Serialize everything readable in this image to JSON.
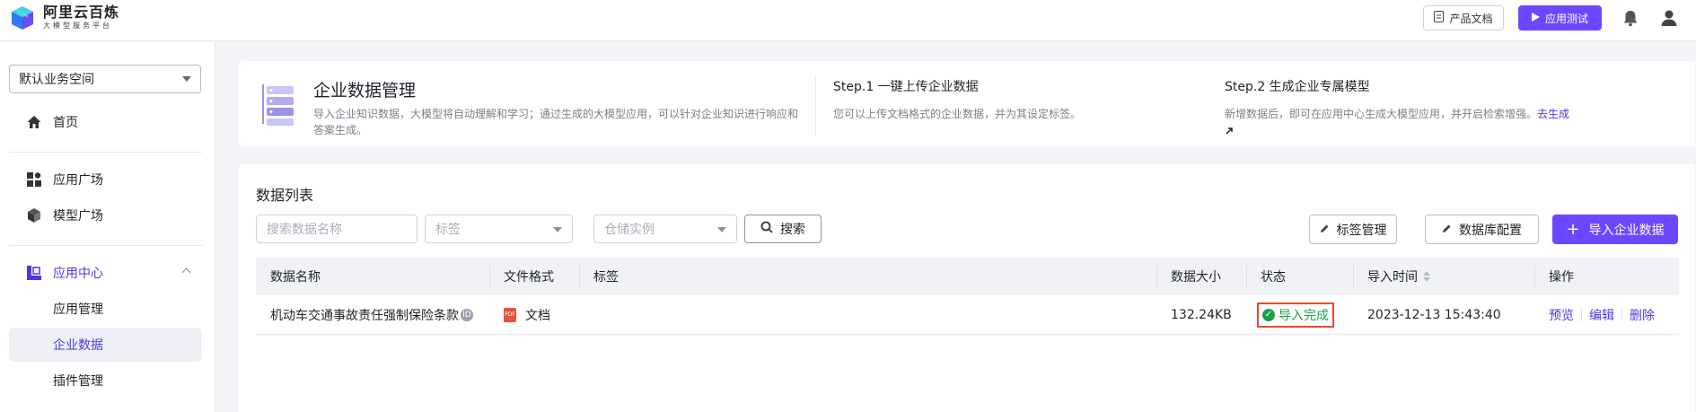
{
  "app": {
    "title": "阿里云百炼",
    "subtitle": "大模型服务平台",
    "doc_button": "产品文档",
    "test_button": "应用测试"
  },
  "sidebar": {
    "workspace": "默认业务空间",
    "items": {
      "home": "首页",
      "app_square": "应用广场",
      "model_square": "模型广场",
      "app_center": "应用中心"
    },
    "sub_items": {
      "app_manage": "应用管理",
      "enterprise_data": "企业数据",
      "plugin_manage": "插件管理"
    }
  },
  "header": {
    "title": "企业数据管理",
    "description": "导入企业知识数据，大模型将自动理解和学习；通过生成的大模型应用，可以针对企业知识进行响应和答案生成。",
    "step1_title": "Step.1 一键上传企业数据",
    "step1_desc": "您可以上传文档格式的企业数据，并为其设定标签。",
    "step2_title": "Step.2 生成企业专属模型",
    "step2_desc": "新增数据后，即可在应用中心生成大模型应用，并开启检索增强。",
    "step2_link": "去生成"
  },
  "list": {
    "title": "数据列表",
    "search_placeholder": "搜索数据名称",
    "tag_placeholder": "标签",
    "store_placeholder": "仓储实例",
    "search_button": "搜索",
    "tag_manage_button": "标签管理",
    "db_config_button": "数据库配置",
    "import_button": "导入企业数据",
    "columns": {
      "name": "数据名称",
      "format": "文件格式",
      "tags": "标签",
      "size": "数据大小",
      "status": "状态",
      "import_time": "导入时间",
      "actions": "操作"
    },
    "rows": [
      {
        "name": "机动车交通事故责任强制保险条款",
        "format": "文档",
        "tags": "",
        "size": "132.24KB",
        "status": "导入完成",
        "import_time": "2023-12-13 15:43:40",
        "actions": {
          "preview": "预览",
          "edit": "编辑",
          "delete": "删除"
        }
      }
    ]
  },
  "colors": {
    "accent": "#6b48ff",
    "link": "#4a3bdc",
    "success": "#1aa34a",
    "highlight": "#e84a2e"
  }
}
